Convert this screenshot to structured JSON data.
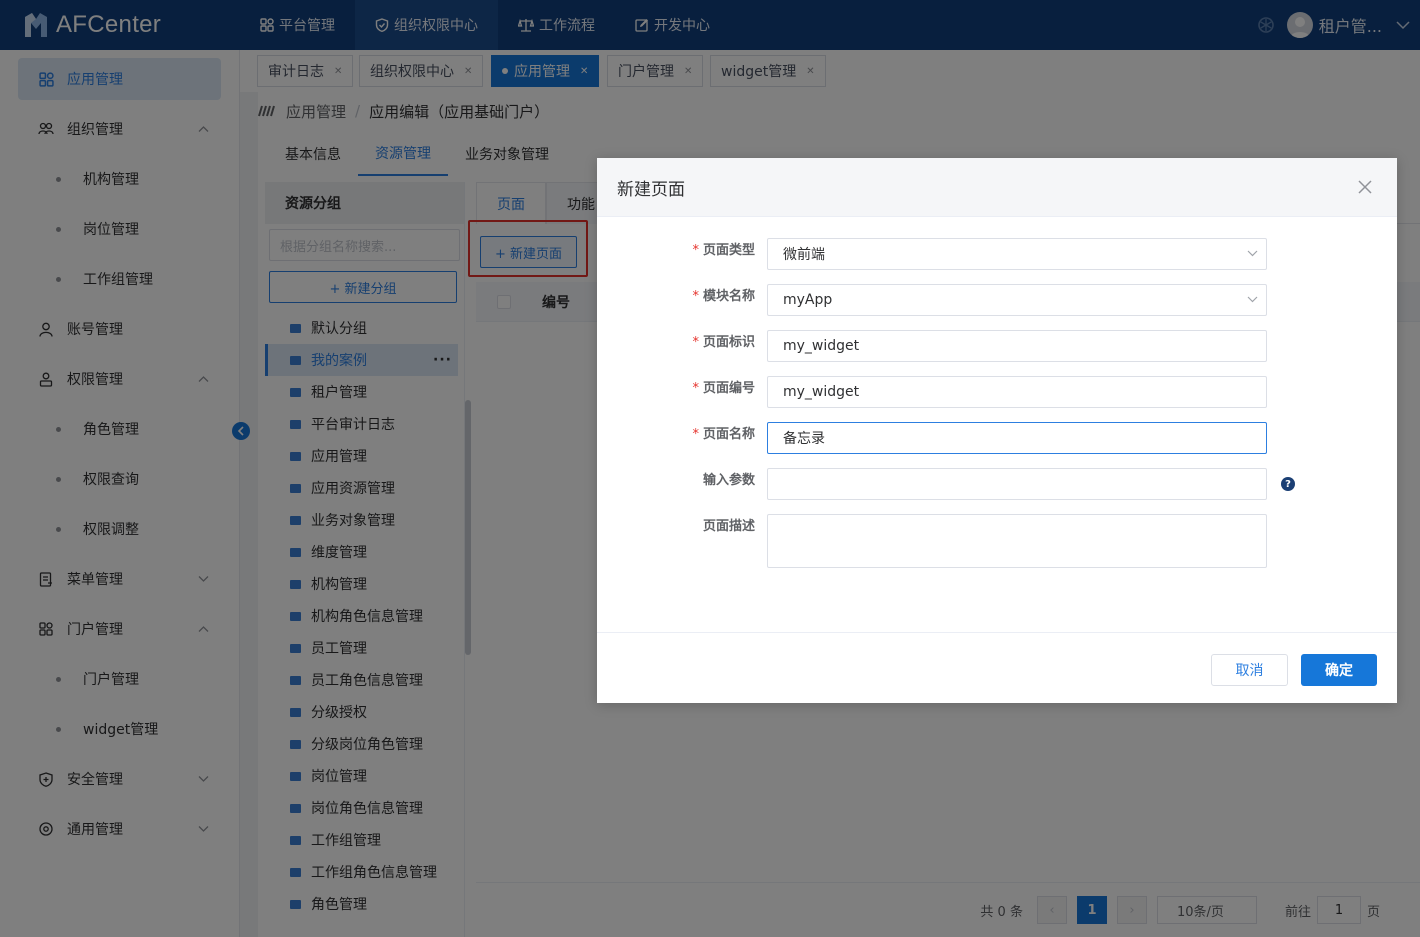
{
  "app": {
    "logo_text": "AFCenter"
  },
  "topnav": [
    {
      "label": "平台管理",
      "icon": "grid-icon"
    },
    {
      "label": "组织权限中心",
      "icon": "shield-icon",
      "active": true
    },
    {
      "label": "工作流程",
      "icon": "scale-icon"
    },
    {
      "label": "开发中心",
      "icon": "edit-icon"
    }
  ],
  "user": {
    "name": "租户管..."
  },
  "sidebar": {
    "items": [
      {
        "label": "应用管理",
        "active": true
      },
      {
        "label": "组织管理",
        "expanded": true,
        "children": [
          "机构管理",
          "岗位管理",
          "工作组管理"
        ]
      },
      {
        "label": "账号管理"
      },
      {
        "label": "权限管理",
        "expanded": true,
        "children": [
          "角色管理",
          "权限查询",
          "权限调整"
        ]
      },
      {
        "label": "菜单管理",
        "expanded": false
      },
      {
        "label": "门户管理",
        "expanded": true,
        "children": [
          "门户管理",
          "widget管理"
        ]
      },
      {
        "label": "安全管理",
        "expanded": false
      },
      {
        "label": "通用管理",
        "expanded": false
      }
    ]
  },
  "tabs": [
    {
      "label": "审计日志"
    },
    {
      "label": "组织权限中心"
    },
    {
      "label": "应用管理",
      "active": true
    },
    {
      "label": "门户管理"
    },
    {
      "label": "widget管理"
    }
  ],
  "breadcrumb": {
    "parent": "应用管理",
    "separator": "/",
    "current": "应用编辑（应用基础门户）"
  },
  "subtabs": [
    {
      "label": "基本信息"
    },
    {
      "label": "资源管理",
      "active": true
    },
    {
      "label": "业务对象管理"
    }
  ],
  "groups": {
    "title": "资源分组",
    "search_placeholder": "根据分组名称搜索...",
    "new_button": "+ 新建分组",
    "selected_more": "···",
    "items": [
      "默认分组",
      "我的案例",
      "租户管理",
      "平台审计日志",
      "应用管理",
      "应用资源管理",
      "业务对象管理",
      "维度管理",
      "机构管理",
      "机构角色信息管理",
      "员工管理",
      "员工角色信息管理",
      "分级授权",
      "分级岗位角色管理",
      "岗位管理",
      "岗位角色信息管理",
      "工作组管理",
      "工作组角色信息管理",
      "角色管理"
    ]
  },
  "page_area": {
    "inner_tabs": [
      "页面",
      "功能"
    ],
    "new_page_button": "+ 新建页面",
    "column_code": "编号",
    "pager": {
      "total": "共 0 条",
      "current": "1",
      "size": "10条/页",
      "goto_label": "前往",
      "goto_value": "1",
      "goto_suffix": "页"
    }
  },
  "modal": {
    "title": "新建页面",
    "fields": {
      "page_type": {
        "label": "页面类型",
        "value": "微前端"
      },
      "module_name": {
        "label": "模块名称",
        "value": "myApp"
      },
      "page_id": {
        "label": "页面标识",
        "value": "my_widget"
      },
      "page_code": {
        "label": "页面编号",
        "value": "my_widget"
      },
      "page_name": {
        "label": "页面名称",
        "value": "备忘录"
      },
      "input_params": {
        "label": "输入参数",
        "value": ""
      },
      "page_desc": {
        "label": "页面描述",
        "value": ""
      }
    },
    "required_mark": "*",
    "help": "?",
    "cancel": "取消",
    "ok": "确定"
  },
  "colors": {
    "topbar": "#103f7c",
    "primary": "#1677d9",
    "highlight": "#e5312b"
  }
}
